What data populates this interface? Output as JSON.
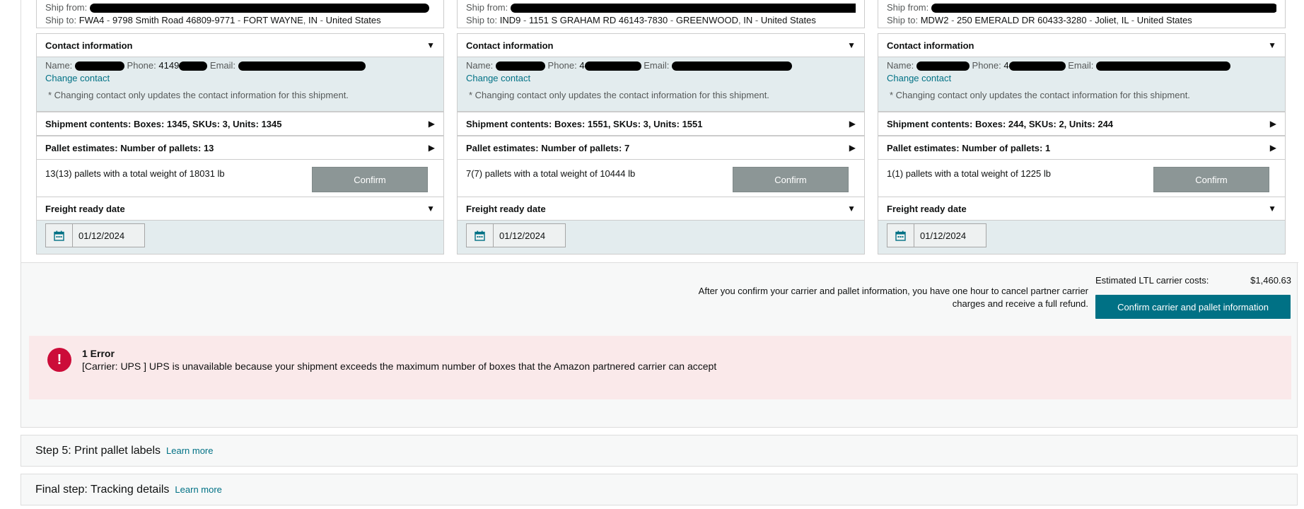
{
  "shipments": [
    {
      "ship_from_label": "Ship from:",
      "ship_to_label": "Ship to:",
      "ship_to_code": "FWA4",
      "ship_to_address": "9798 Smith Road  46809-9771",
      "ship_to_city": "FORT WAYNE",
      "ship_to_state": "IN",
      "ship_to_country": "United States",
      "contact_header": "Contact information",
      "name_label": "Name:",
      "phone_label": "Phone:",
      "phone_partial": "4149",
      "email_label": "Email:",
      "change_contact": "Change contact",
      "contact_note": "* Changing contact only updates the contact information for this shipment.",
      "contents": "Shipment contents: Boxes: 1345, SKUs: 3, Units: 1345",
      "pallet_estimates": "Pallet estimates: Number of pallets: 13",
      "pallet_text": "13(13) pallets with a total weight of 18031 lb",
      "confirm_label": "Confirm",
      "freight_header": "Freight ready date",
      "freight_date": "01/12/2024"
    },
    {
      "ship_from_label": "Ship from:",
      "ship_to_label": "Ship to:",
      "ship_to_code": "IND9",
      "ship_to_address": "1151 S GRAHAM RD  46143-7830",
      "ship_to_city": "GREENWOOD",
      "ship_to_state": "IN",
      "ship_to_country": "United States",
      "contact_header": "Contact information",
      "name_label": "Name:",
      "phone_label": "Phone:",
      "phone_partial": "4",
      "email_label": "Email:",
      "change_contact": "Change contact",
      "contact_note": "* Changing contact only updates the contact information for this shipment.",
      "contents": "Shipment contents: Boxes: 1551, SKUs: 3, Units: 1551",
      "pallet_estimates": "Pallet estimates: Number of pallets: 7",
      "pallet_text": "7(7) pallets with a total weight of 10444 lb",
      "confirm_label": "Confirm",
      "freight_header": "Freight ready date",
      "freight_date": "01/12/2024"
    },
    {
      "ship_from_label": "Ship from:",
      "ship_to_label": "Ship to:",
      "ship_to_code": "MDW2",
      "ship_to_address": "250 EMERALD DR  60433-3280",
      "ship_to_city": "Joliet",
      "ship_to_state": "IL",
      "ship_to_country": "United States",
      "contact_header": "Contact information",
      "name_label": "Name:",
      "phone_label": "Phone:",
      "phone_partial": "4",
      "email_label": "Email:",
      "change_contact": "Change contact",
      "contact_note": "* Changing contact only updates the contact information for this shipment.",
      "contents": "Shipment contents: Boxes: 244, SKUs: 2, Units: 244",
      "pallet_estimates": "Pallet estimates: Number of pallets: 1",
      "pallet_text": "1(1) pallets with a total weight of 1225 lb",
      "confirm_label": "Confirm",
      "freight_header": "Freight ready date",
      "freight_date": "01/12/2024"
    }
  ],
  "summary": {
    "est_label": "Estimated LTL carrier costs:",
    "est_value": "$1,460.63",
    "after_text": "After you confirm your carrier and pallet information, you have one hour to cancel partner carrier charges and receive a full refund.",
    "confirm_all": "Confirm carrier and pallet information"
  },
  "error": {
    "icon": "!",
    "title": "1 Error",
    "message": "[Carrier: UPS ]  UPS is unavailable because your shipment exceeds the maximum number of boxes that the Amazon partnered carrier can accept"
  },
  "steps": [
    {
      "title": "Step 5: Print pallet labels",
      "link": "Learn more"
    },
    {
      "title": "Final step: Tracking details",
      "link": "Learn more"
    }
  ],
  "colors": {
    "link": "#007185",
    "primary_button": "#007185",
    "error_bg": "#fae9ea",
    "error_icon": "#cc0c39",
    "panel_bg": "#e3ecee"
  }
}
